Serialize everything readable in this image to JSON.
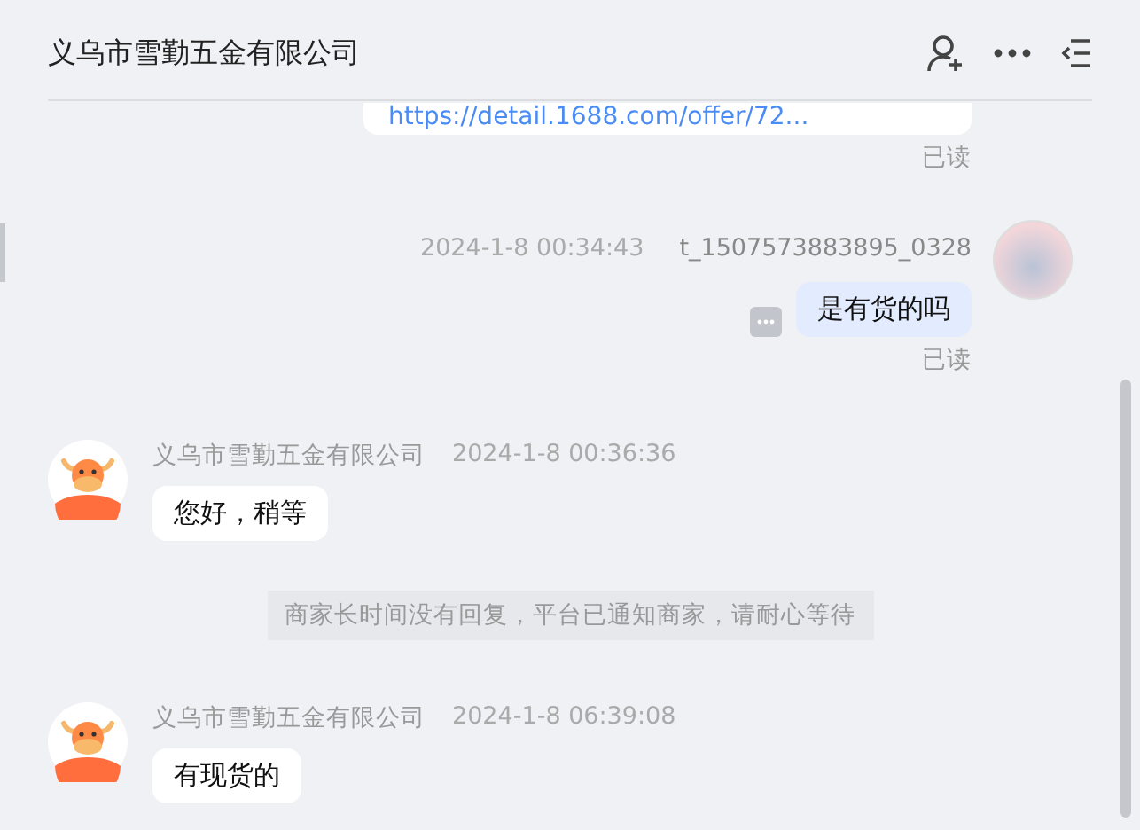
{
  "header": {
    "title": "义乌市雪勤五金有限公司"
  },
  "messages": [
    {
      "kind": "link",
      "text": "https://detail.1688.com/offer/72...",
      "read_status": "已读"
    },
    {
      "kind": "self",
      "time": "2024-1-8 00:34:43",
      "sender": "t_1507573883895_0328",
      "text": "是有货的吗",
      "read_status": "已读"
    },
    {
      "kind": "other",
      "sender": "义乌市雪勤五金有限公司",
      "time": "2024-1-8 00:36:36",
      "text": "您好，稍等"
    },
    {
      "kind": "system",
      "text": "商家长时间没有回复，平台已通知商家，请耐心等待"
    },
    {
      "kind": "other",
      "sender": "义乌市雪勤五金有限公司",
      "time": "2024-1-8 06:39:08",
      "text": "有现货的"
    }
  ]
}
